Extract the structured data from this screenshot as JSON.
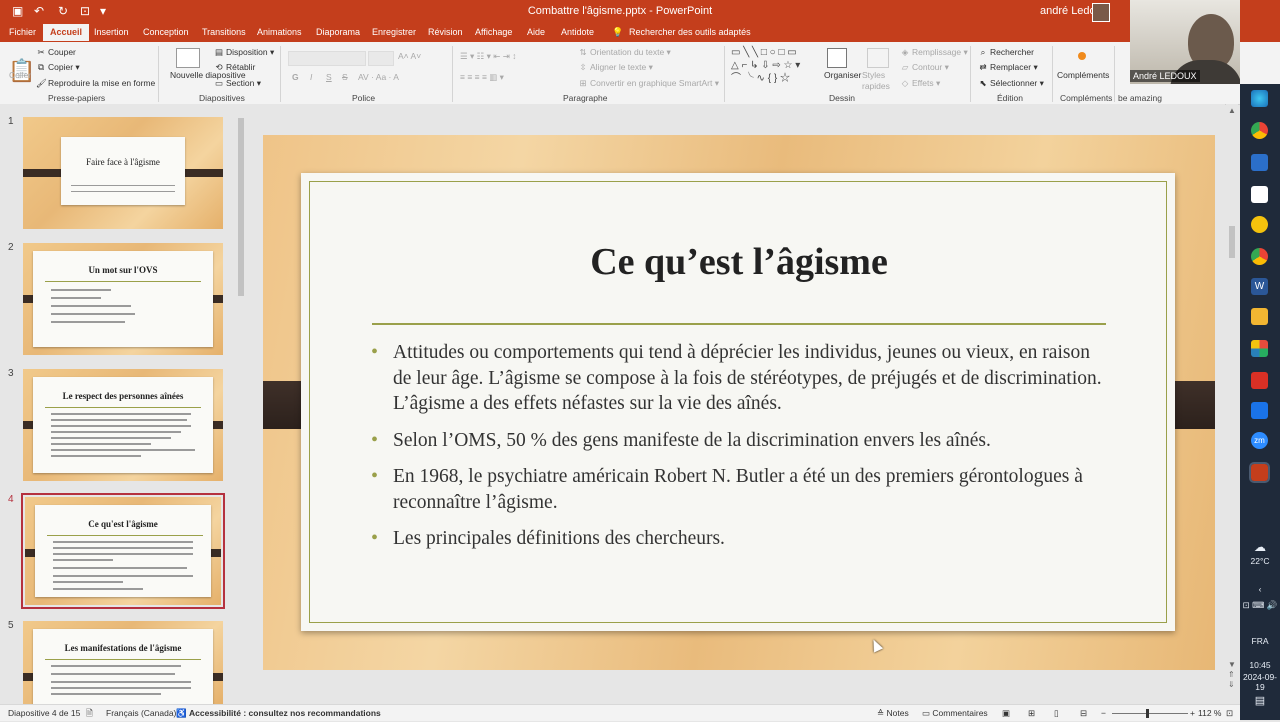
{
  "title_bar": {
    "document_title": "Combattre l'âgisme.pptx  -  PowerPoint",
    "user": "andré Ledoux"
  },
  "tabs": [
    "Fichier",
    "Accueil",
    "Insertion",
    "Conception",
    "Transitions",
    "Animations",
    "Diaporama",
    "Enregistrer",
    "Révision",
    "Affichage",
    "Aide",
    "Antidote"
  ],
  "active_tab": "Accueil",
  "search_placeholder": "Rechercher des outils adaptés",
  "ribbon": {
    "clipboard": {
      "paste": "Coller",
      "cut": "Couper",
      "copy": "Copier",
      "format_painter": "Reproduire la mise en forme",
      "group": "Presse-papiers"
    },
    "slides": {
      "new_slide": "Nouvelle diapositive",
      "layout": "Disposition",
      "reset": "Rétablir",
      "section": "Section",
      "group": "Diapositives"
    },
    "font": {
      "bold": "G",
      "italic": "I",
      "underline": "S",
      "strike": "S",
      "group": "Police"
    },
    "paragraph": {
      "text_direction": "Orientation du texte",
      "align_text": "Aligner le texte",
      "smartart": "Convertir en graphique SmartArt",
      "group": "Paragraphe"
    },
    "drawing": {
      "arrange": "Organiser",
      "quick_styles": "Styles rapides",
      "fill": "Remplissage",
      "outline": "Contour",
      "effects": "Effets",
      "group": "Dessin"
    },
    "editing": {
      "find": "Rechercher",
      "replace": "Remplacer",
      "select": "Sélectionner",
      "group": "Édition"
    },
    "addins": {
      "label": "Compléments",
      "group": "Compléments"
    },
    "extra_group": "be amazing"
  },
  "webcam_label": "André LEDOUX",
  "thumbnails": [
    {
      "num": "1",
      "title": "Faire face à l'âgisme"
    },
    {
      "num": "2",
      "title": "Un mot sur l'OVS"
    },
    {
      "num": "3",
      "title": "Le respect des personnes aînées"
    },
    {
      "num": "4",
      "title": "Ce qu'est l'âgisme"
    },
    {
      "num": "5",
      "title": "Les manifestations de l'âgisme"
    }
  ],
  "slide": {
    "title": "Ce qu’est l’âgisme",
    "bullets": [
      "Attitudes ou comportements qui tend à déprécier les individus, jeunes ou vieux, en raison de leur âge. L’âgisme se compose à la fois de stéréotypes, de préjugés et de discrimination.  L’âgisme a des effets néfastes sur la vie des aînés.",
      "Selon l’OMS, 50 % des gens manifeste de la discrimination envers les aînés.",
      "En 1968, le psychiatre américain Robert N. Butler a été un des premiers gérontologues à reconnaître l’âgisme.",
      "Les principales définitions des chercheurs."
    ],
    "accent_color": "#9aa04a"
  },
  "status_bar": {
    "slide_counter": "Diapositive 4 de 15",
    "language": "Français (Canada)",
    "accessibility": "Accessibilité : consultez nos recommandations",
    "notes": "Notes",
    "comments": "Commentaires",
    "zoom": "112 %"
  },
  "taskbar": {
    "weather": "22°C",
    "lang": "FRA",
    "time": "10:45",
    "date": "2024-09-19"
  },
  "colors": {
    "brand": "#c43e1c",
    "selected_thumb": "#b5313e"
  }
}
